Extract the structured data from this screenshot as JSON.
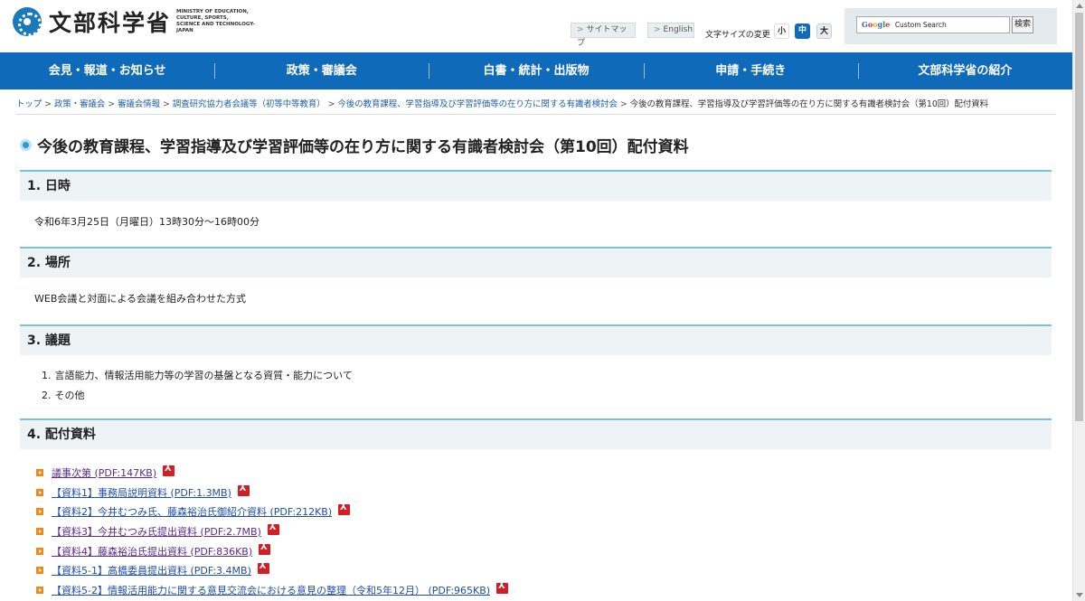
{
  "header": {
    "logo_text": "文部科学省",
    "logo_en_lines": [
      "MINISTRY OF EDUCATION,",
      "CULTURE, SPORTS,",
      "SCIENCE AND TECHNOLOGY-JAPAN"
    ],
    "sitemap_label": "サイトマップ",
    "english_label": "English",
    "fontsize_label": "文字サイズの変更",
    "fontsize_small": "小",
    "fontsize_medium": "中",
    "fontsize_large": "大",
    "search_custom_label": "Custom Search",
    "search_button": "検索"
  },
  "nav": {
    "items": [
      {
        "label": "会見・報道・お知らせ"
      },
      {
        "label": "政策・審議会"
      },
      {
        "label": "白書・統計・出版物"
      },
      {
        "label": "申請・手続き"
      },
      {
        "label": "文部科学省の紹介"
      }
    ]
  },
  "breadcrumb": {
    "items": [
      {
        "label": "トップ"
      },
      {
        "label": "政策・審議会"
      },
      {
        "label": "審議会情報"
      },
      {
        "label": "調査研究協力者会議等（初等中等教育）"
      },
      {
        "label": "今後の教育課程、学習指導及び学習評価等の在り方に関する有識者検討会"
      }
    ],
    "current": "今後の教育課程、学習指導及び学習評価等の在り方に関する有識者検討会（第10回）配付資料"
  },
  "page": {
    "title": "今後の教育課程、学習指導及び学習評価等の在り方に関する有識者検討会（第10回）配付資料"
  },
  "sections": {
    "datetime": {
      "heading": "1. 日時",
      "text": "令和6年3月25日（月曜日）13時30分～16時00分"
    },
    "place": {
      "heading": "2. 場所",
      "text": "WEB会議と対面による会議を組み合わせた方式"
    },
    "agenda": {
      "heading": "3. 議題",
      "items": [
        {
          "num": "1.",
          "text": "言語能力、情報活用能力等の学習の基盤となる資質・能力について"
        },
        {
          "num": "2.",
          "text": "その他"
        }
      ]
    },
    "documents": {
      "heading": "4. 配付資料",
      "items": [
        {
          "label": "議事次第 (PDF:147KB)"
        },
        {
          "label": "【資料1】事務局説明資料 (PDF:1.3MB)"
        },
        {
          "label": "【資料2】今井むつみ氏、藤森裕治氏御紹介資料 (PDF:212KB)"
        },
        {
          "label": "【資料3】今井むつみ氏提出資料 (PDF:2.7MB)"
        },
        {
          "label": "【資料4】藤森裕治氏提出資料 (PDF:836KB)"
        },
        {
          "label": "【資料5-1】高橋委員提出資料 (PDF:3.4MB)"
        },
        {
          "label": "【資料5-2】情報活用能力に関する意見交流会における意見の整理（令和5年12月） (PDF:965KB)"
        }
      ]
    }
  },
  "colors": {
    "nav_bg": "#0f6ab9",
    "section_border": "#76c3da",
    "section_bg": "#eef4f6",
    "link": "#1f4eaa",
    "visited_link": "#5b2a8e",
    "bullet": "#ee8a1b",
    "pdf_icon": "#d21f26"
  },
  "icons": {
    "logo": "mext-logo-icon",
    "title": "circle-bullet-icon",
    "pdf": "pdf-icon",
    "bullet": "arrow-bullet-icon"
  }
}
